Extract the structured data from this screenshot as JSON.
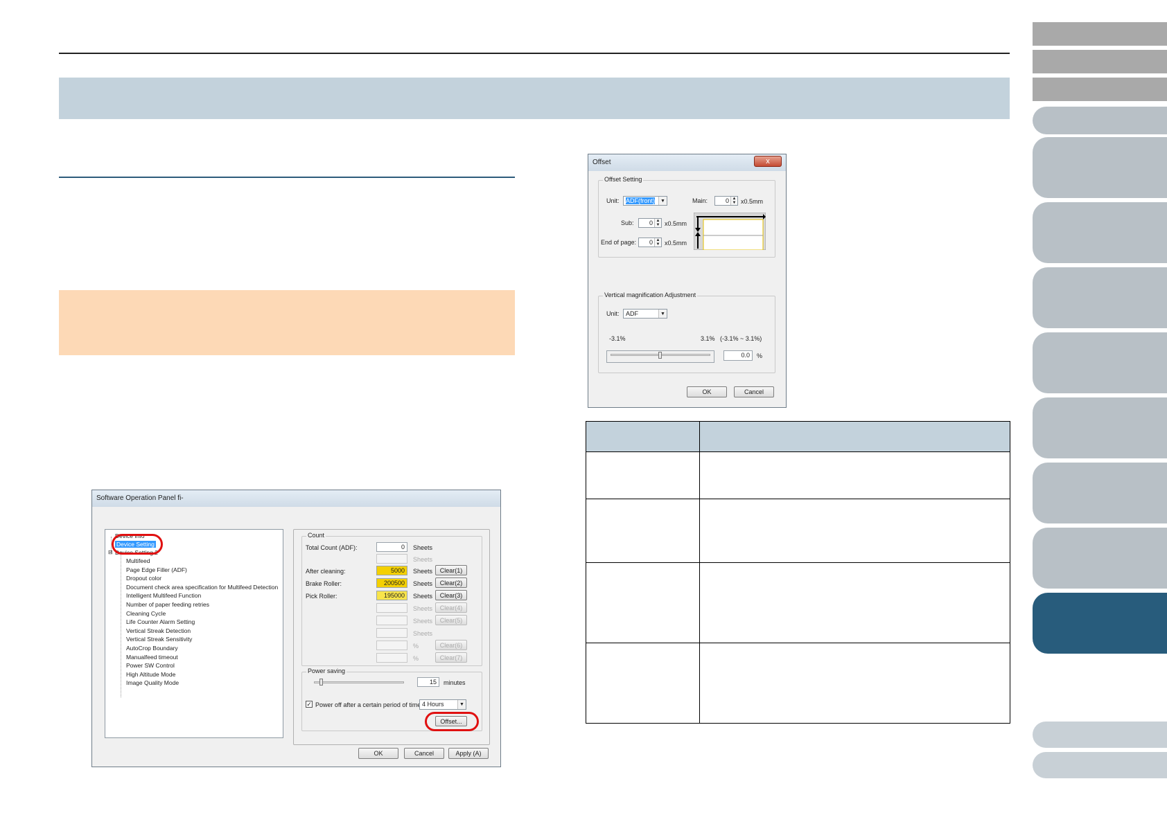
{
  "main_dialog": {
    "title": "Software Operation Panel fi-",
    "tree": {
      "device_info": "Device Info",
      "device_setting": "Device Setting",
      "device_setting_2": "Device Setting 2",
      "children": [
        "Multifeed",
        "Page Edge Filler (ADF)",
        "Dropout color",
        "Document check area specification for Multifeed Detection",
        "Intelligent Multifeed Function",
        "Number of paper feeding retries",
        "Cleaning Cycle",
        "Life Counter Alarm Setting",
        "Vertical Streak Detection",
        "Vertical Streak Sensitivity",
        "AutoCrop Boundary",
        "Manualfeed timeout",
        "Power SW Control",
        "High Altitude Mode",
        "Image Quality Mode"
      ]
    },
    "count": {
      "label": "Count",
      "total_count_label": "Total Count (ADF):",
      "total_count_value": "0",
      "after_cleaning_label": "After cleaning:",
      "after_cleaning_value": "5000",
      "brake_roller_label": "Brake Roller:",
      "brake_roller_value": "200500",
      "pick_roller_label": "Pick Roller:",
      "pick_roller_value": "195000",
      "sheets": "Sheets",
      "percent": "%",
      "clear_buttons": [
        "Clear(1)",
        "Clear(2)",
        "Clear(3)",
        "Clear(4)",
        "Clear(5)",
        "Clear(6)",
        "Clear(7)"
      ]
    },
    "power_saving": {
      "label": "Power saving",
      "minutes_value": "15",
      "minutes_label": "minutes",
      "power_off_label": "Power off after a certain period of time",
      "power_off_checked": true,
      "power_off_period": "4 Hours"
    },
    "offset_button": "Offset...",
    "ok_button": "OK",
    "cancel_button": "Cancel",
    "apply_button": "Apply (A)"
  },
  "offset_dialog": {
    "title": "Offset",
    "close_glyph": "x",
    "offset_setting_label": "Offset Setting",
    "unit_label": "Unit:",
    "unit_value": "ADF(front)",
    "main_label": "Main:",
    "main_value": "0",
    "unit_mm": "x0.5mm",
    "sub_label": "Sub:",
    "sub_value": "0",
    "end_of_page_label": "End of page:",
    "end_of_page_value": "0",
    "vma_label": "Vertical magnification Adjustment",
    "vma_unit_label": "Unit:",
    "vma_unit_value": "ADF",
    "vma_min": "-3.1%",
    "vma_max": "3.1%",
    "vma_range": "(-3.1% ~ 3.1%)",
    "vma_value": "0.0",
    "vma_percent": "%",
    "ok_button": "OK",
    "cancel_button": "Cancel"
  },
  "colors": {
    "title_band": "#c3d2dc",
    "note_box": "#fdd9b6",
    "nav_active": "#285c7c",
    "highlight_oval": "#e01010"
  }
}
